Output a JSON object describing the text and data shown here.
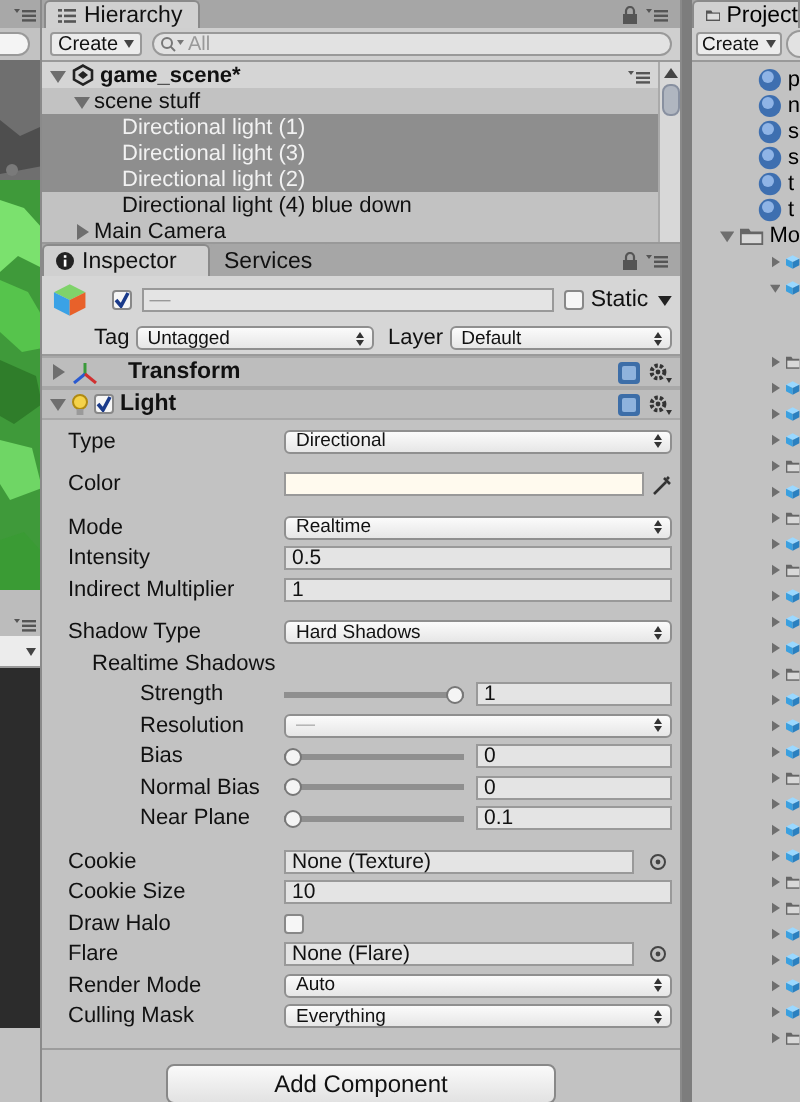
{
  "hierarchy": {
    "title": "Hierarchy",
    "create": "Create",
    "search": {
      "placeholder": "All"
    },
    "scene": "game_scene*",
    "items": [
      {
        "label": "scene stuff",
        "expanded": true,
        "selected": false,
        "children": [
          {
            "label": "Directional light (1)",
            "selected": true
          },
          {
            "label": "Directional light (3)",
            "selected": true
          },
          {
            "label": "Directional light (2)",
            "selected": true
          },
          {
            "label": "Directional light (4) blue down",
            "selected": false
          }
        ]
      },
      {
        "label": "Main Camera",
        "expanded": false,
        "selected": false
      }
    ]
  },
  "inspector": {
    "tabs": [
      {
        "label": "Inspector",
        "selected": true
      },
      {
        "label": "Services",
        "selected": false
      }
    ],
    "object": {
      "active": true,
      "name": "—",
      "static": false,
      "static_label": "Static",
      "tag_label": "Tag",
      "tag": "Untagged",
      "layer_label": "Layer",
      "layer": "Default"
    },
    "components": [
      {
        "title": "Transform",
        "kind": "transform",
        "expanded": false
      },
      {
        "title": "Light",
        "kind": "light",
        "expanded": true,
        "enabled": true,
        "groups": [
          [
            {
              "kind": "dropdown",
              "label": "Type",
              "value": "Directional"
            }
          ],
          [
            {
              "kind": "color",
              "label": "Color",
              "color": "#fffaee"
            }
          ],
          [
            {
              "kind": "dropdown",
              "label": "Mode",
              "value": "Realtime"
            },
            {
              "kind": "number",
              "label": "Intensity",
              "value": "0.5"
            },
            {
              "kind": "number",
              "label": "Indirect Multiplier",
              "value": "1"
            }
          ],
          [
            {
              "kind": "dropdown",
              "label": "Shadow Type",
              "value": "Hard Shadows"
            },
            {
              "kind": "header",
              "label": "Realtime Shadows",
              "children": [
                {
                  "kind": "slider",
                  "label": "Strength",
                  "level": 1,
                  "value": "1"
                },
                {
                  "kind": "dropdown",
                  "label": "Resolution",
                  "value": "—",
                  "disabled": true
                },
                {
                  "kind": "slider",
                  "label": "Bias",
                  "level": 0,
                  "value": "0"
                },
                {
                  "kind": "slider",
                  "label": "Normal Bias",
                  "level": 0,
                  "value": "0"
                },
                {
                  "kind": "slider",
                  "label": "Near Plane",
                  "level": 0,
                  "value": "0.1"
                }
              ]
            }
          ],
          [
            {
              "kind": "object",
              "label": "Cookie",
              "value": "None (Texture)"
            },
            {
              "kind": "number",
              "label": "Cookie Size",
              "value": "10"
            },
            {
              "kind": "checkbox",
              "label": "Draw Halo",
              "checked": false
            },
            {
              "kind": "object",
              "label": "Flare",
              "value": "None (Flare)"
            },
            {
              "kind": "dropdown",
              "label": "Render Mode",
              "value": "Auto"
            },
            {
              "kind": "dropdown",
              "label": "Culling Mask",
              "value": "Everything"
            }
          ]
        ]
      }
    ],
    "add_button": "Add Component"
  },
  "project": {
    "title": "Project",
    "create": "Create",
    "assets": [
      {
        "label": "p"
      },
      {
        "label": "n"
      },
      {
        "label": "s"
      },
      {
        "label": "s"
      },
      {
        "label": "t"
      },
      {
        "label": "t"
      }
    ],
    "folder": {
      "label": "Mo",
      "expanded": true
    },
    "rows": [
      {
        "kind": "cube",
        "expanded": false
      },
      {
        "kind": "cube",
        "expanded": true
      },
      {
        "kind": "folder",
        "expanded": false
      },
      {
        "kind": "cube",
        "expanded": false
      },
      {
        "kind": "cube",
        "expanded": false
      },
      {
        "kind": "cube",
        "expanded": false
      },
      {
        "kind": "folder",
        "expanded": false
      },
      {
        "kind": "cube",
        "expanded": false
      },
      {
        "kind": "folder",
        "expanded": false
      },
      {
        "kind": "cube",
        "expanded": false
      },
      {
        "kind": "folder",
        "expanded": false
      },
      {
        "kind": "cube",
        "expanded": false
      },
      {
        "kind": "cube",
        "expanded": false
      },
      {
        "kind": "cube",
        "expanded": false
      },
      {
        "kind": "folder",
        "expanded": false
      },
      {
        "kind": "cube",
        "expanded": false
      },
      {
        "kind": "cube",
        "expanded": false
      },
      {
        "kind": "cube",
        "expanded": false
      },
      {
        "kind": "folder",
        "expanded": false
      },
      {
        "kind": "cube",
        "expanded": false
      },
      {
        "kind": "cube",
        "expanded": false
      },
      {
        "kind": "cube",
        "expanded": false
      },
      {
        "kind": "folder",
        "expanded": false
      },
      {
        "kind": "folder",
        "expanded": false
      },
      {
        "kind": "cube",
        "expanded": false
      },
      {
        "kind": "cube",
        "expanded": false
      },
      {
        "kind": "cube",
        "expanded": false
      },
      {
        "kind": "cube",
        "expanded": false
      },
      {
        "kind": "folder",
        "expanded": false
      }
    ]
  }
}
